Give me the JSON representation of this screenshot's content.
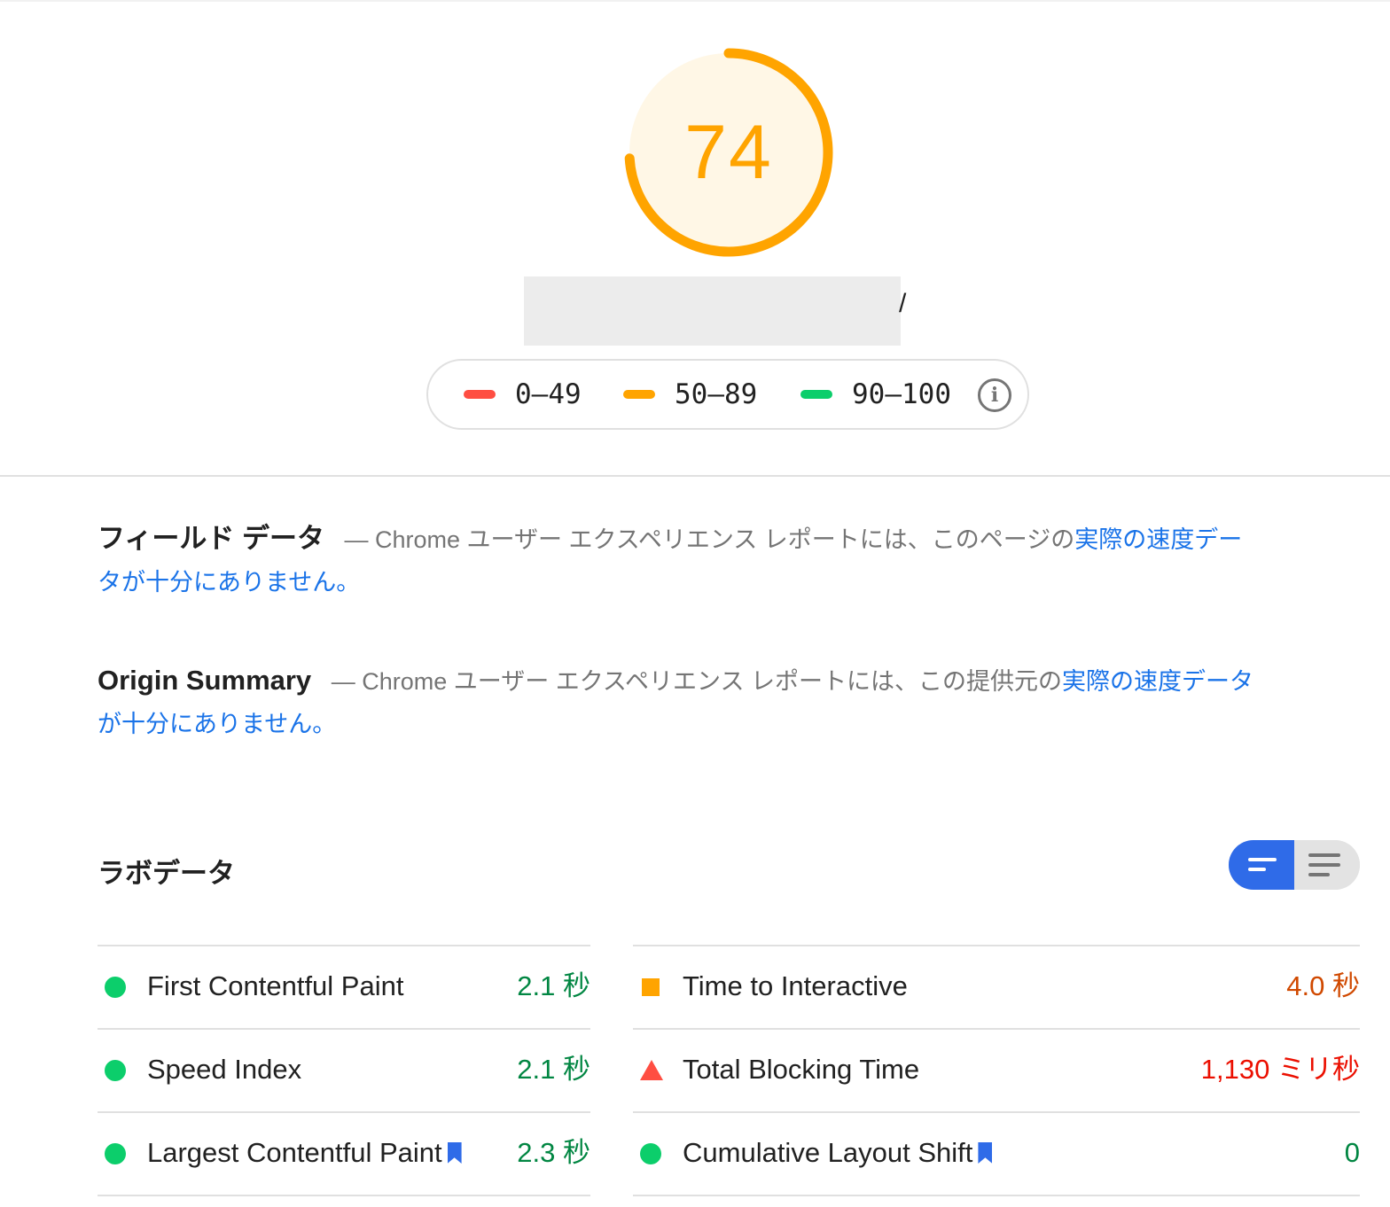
{
  "score": {
    "value": "74",
    "fraction": 0.74,
    "color": "#ffa400",
    "bg_color": "#fff7e6"
  },
  "url_tail": "/",
  "legend": {
    "items": [
      {
        "label": "0–49",
        "color": "#ff4e42"
      },
      {
        "label": "50–89",
        "color": "#ffa400"
      },
      {
        "label": "90–100",
        "color": "#0cce6b"
      }
    ],
    "info_icon": "info-icon"
  },
  "field_data": {
    "title": "フィールド データ",
    "dash": "—",
    "desc": "Chrome ユーザー エクスペリエンス レポートには、このページの",
    "link": "実際の速度データが十分にありません。"
  },
  "origin_summary": {
    "title": "Origin Summary",
    "dash": "—",
    "desc": "Chrome ユーザー エクスペリエンス レポートには、この提供元の",
    "link": "実際の速度データが十分にありません。"
  },
  "lab_data": {
    "title": "ラボデータ",
    "toggle": {
      "selected": "summary-view",
      "icons": [
        "summary-view-icon",
        "detailed-view-icon"
      ]
    }
  },
  "metrics": {
    "left": [
      {
        "name": "First Contentful Paint",
        "value": "2.1 秒",
        "status": "pass",
        "bookmark": false
      },
      {
        "name": "Speed Index",
        "value": "2.1 秒",
        "status": "pass",
        "bookmark": false
      },
      {
        "name": "Largest Contentful Paint",
        "value": "2.3 秒",
        "status": "pass",
        "bookmark": true
      }
    ],
    "right": [
      {
        "name": "Time to Interactive",
        "value": "4.0 秒",
        "status": "average",
        "bookmark": false
      },
      {
        "name": "Total Blocking Time",
        "value": "1,130 ミリ秒",
        "status": "fail",
        "bookmark": false
      },
      {
        "name": "Cumulative Layout Shift",
        "value": "0",
        "status": "pass",
        "bookmark": true
      }
    ]
  },
  "colors": {
    "pass": "#0cce6b",
    "average": "#ffa400",
    "fail": "#ff4e42",
    "link": "#1a73e8",
    "toggle_active": "#2f6be8"
  }
}
